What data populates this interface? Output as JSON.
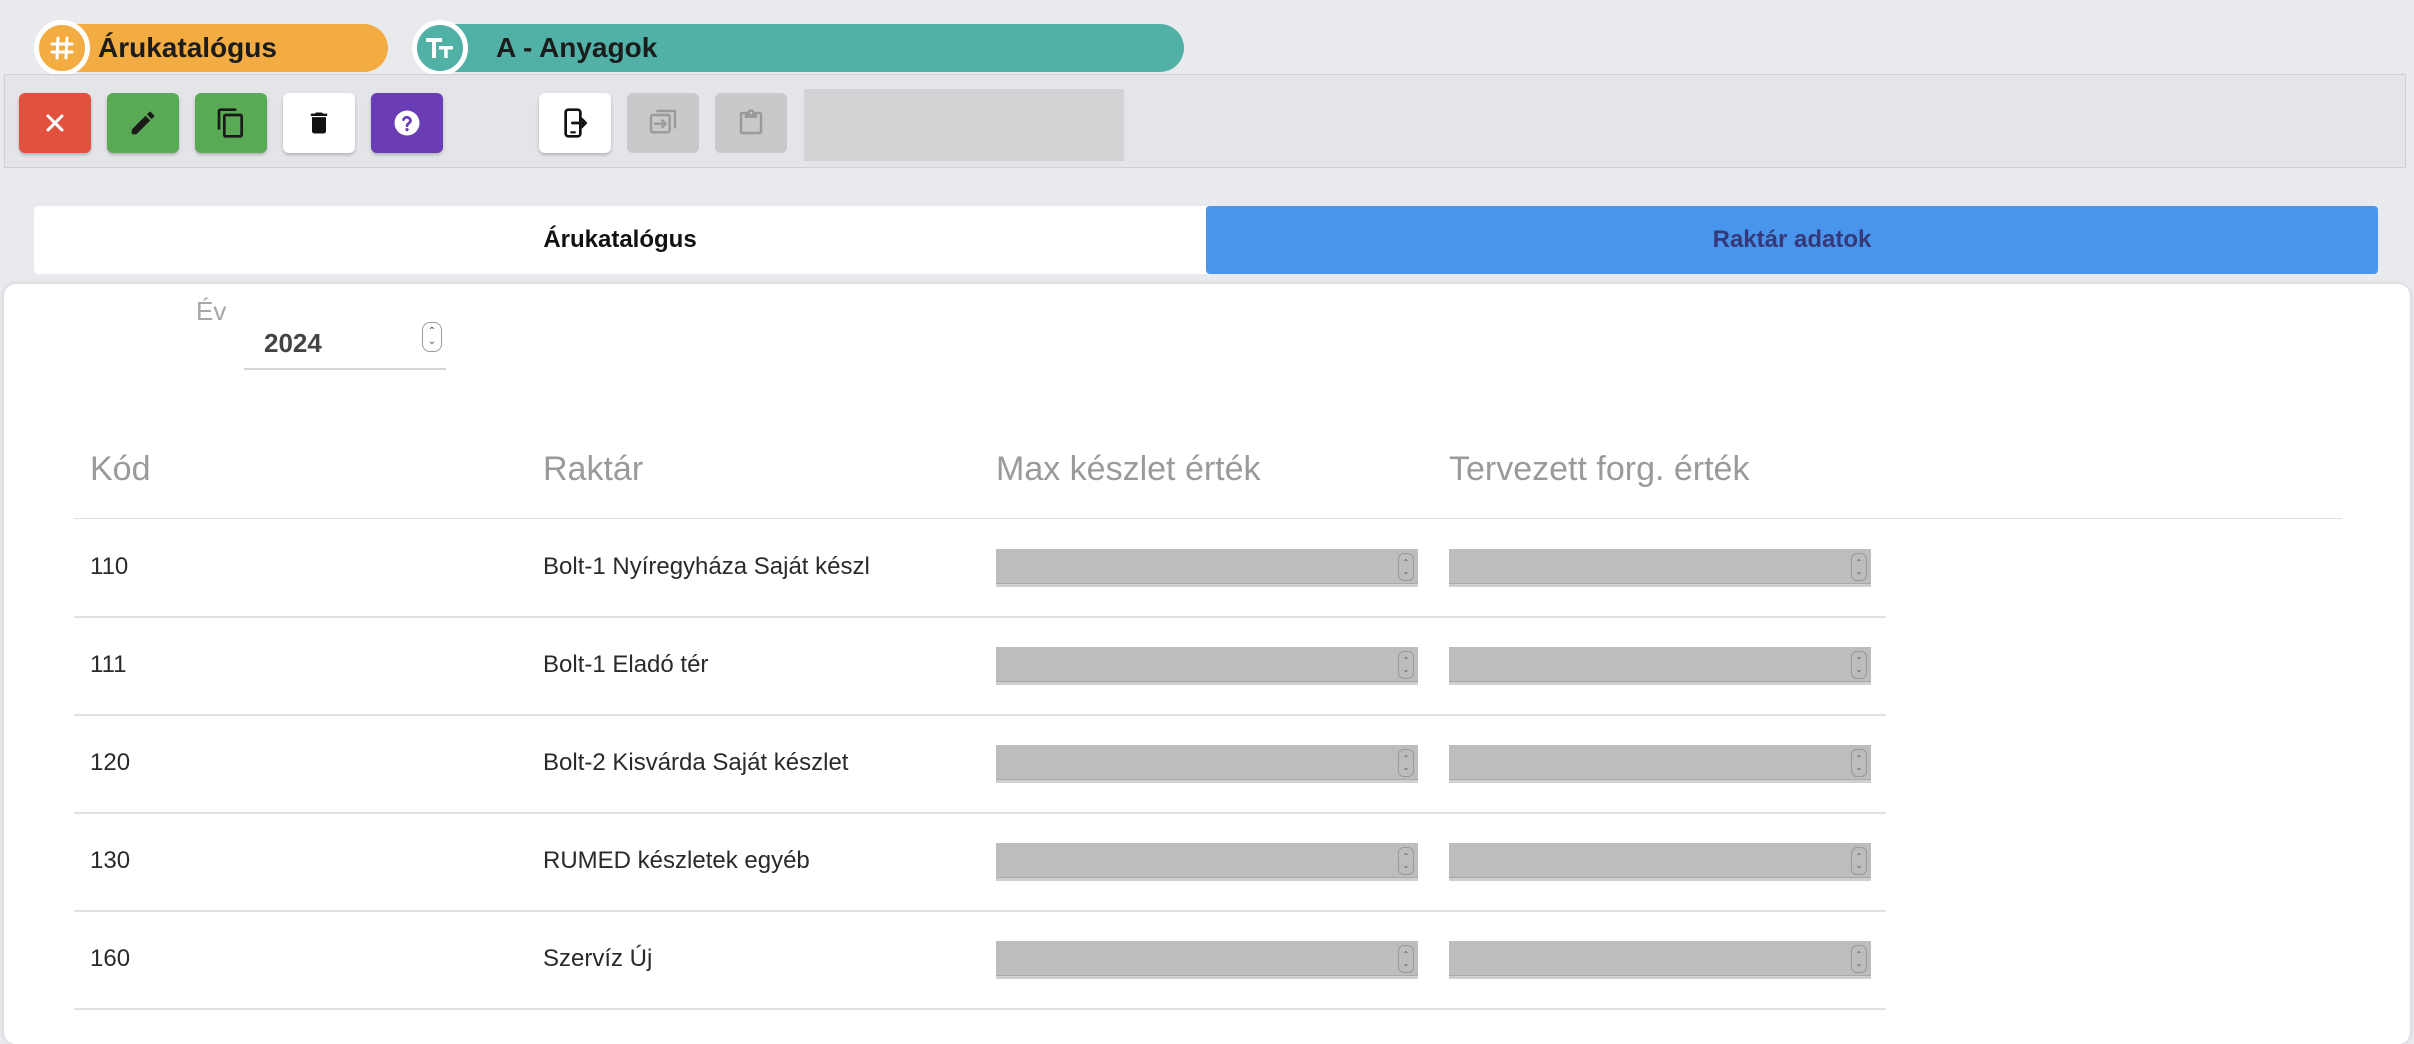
{
  "header": {
    "catalog_pill": {
      "label": "Árukatalógus",
      "icon": "hash-icon",
      "color": "#f3ac41"
    },
    "group_pill": {
      "label": "A - Anyagok",
      "icon": "text-type-icon",
      "color": "#52b1a7"
    }
  },
  "toolbar": {
    "buttons": [
      {
        "icon": "close-icon",
        "color": "#e25140",
        "enabled": true
      },
      {
        "icon": "pencil-icon",
        "color": "#5aaa55",
        "enabled": true
      },
      {
        "icon": "copy-icon",
        "color": "#5aaa55",
        "enabled": true
      },
      {
        "icon": "trash-icon",
        "color": "#ffffff",
        "enabled": true
      },
      {
        "icon": "help-icon",
        "color": "#6a3db4",
        "enabled": true
      },
      {
        "icon": "export-icon",
        "color": "#ffffff",
        "enabled": true
      },
      {
        "icon": "import-icon",
        "color": "#c9c9cb",
        "enabled": false
      },
      {
        "icon": "clipboard-icon",
        "color": "#c9c9cb",
        "enabled": false
      }
    ]
  },
  "tabs": [
    {
      "label": "Árukatalógus",
      "active": false
    },
    {
      "label": "Raktár adatok",
      "active": true,
      "color": "#4a95ec"
    }
  ],
  "filters": {
    "year_label": "Év",
    "year_value": "2024"
  },
  "table": {
    "headers": [
      "Kód",
      "Raktár",
      "Max készlet érték",
      "Tervezett forg. érték"
    ],
    "rows": [
      {
        "code": "110",
        "warehouse": "Bolt-1 Nyíregyháza Saját készl",
        "max_stock_value": "",
        "planned_turnover_value": ""
      },
      {
        "code": "111",
        "warehouse": "Bolt-1 Eladó tér",
        "max_stock_value": "",
        "planned_turnover_value": ""
      },
      {
        "code": "120",
        "warehouse": "Bolt-2 Kisvárda Saját készlet",
        "max_stock_value": "",
        "planned_turnover_value": ""
      },
      {
        "code": "130",
        "warehouse": "RUMED készletek egyéb",
        "max_stock_value": "",
        "planned_turnover_value": ""
      },
      {
        "code": "160",
        "warehouse": "Szervíz Új",
        "max_stock_value": "",
        "planned_turnover_value": ""
      }
    ]
  }
}
